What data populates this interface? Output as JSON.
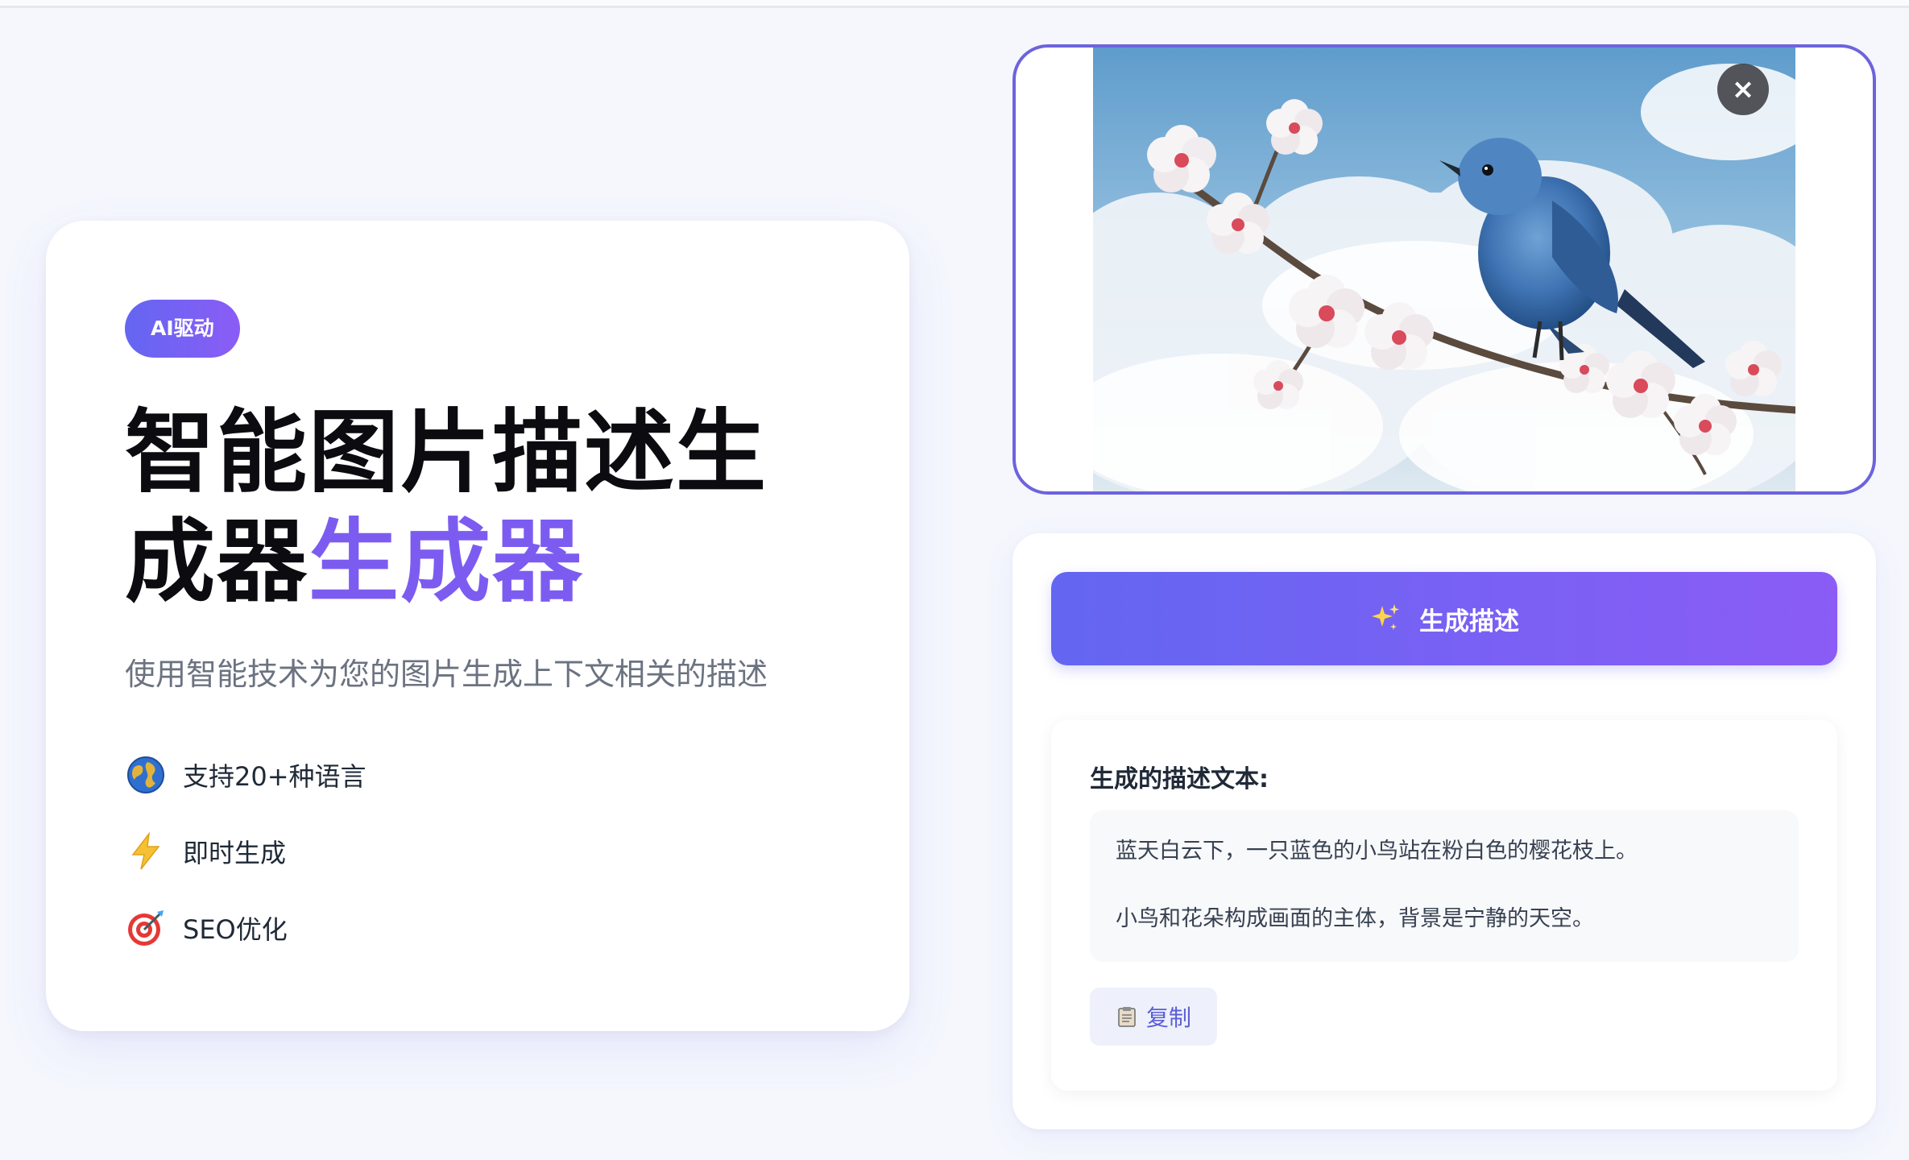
{
  "hero": {
    "badge": "AI驱动",
    "title_line1": "智能图片描述生",
    "title_line2_dark": "成器",
    "title_line2_accent": "生成器",
    "subtitle": "使用智能技术为您的图片生成上下文相关的描述",
    "features": [
      {
        "icon": "globe-icon",
        "label": "支持20+种语言"
      },
      {
        "icon": "lightning-icon",
        "label": "即时生成"
      },
      {
        "icon": "target-icon",
        "label": "SEO优化"
      }
    ]
  },
  "image_card": {
    "close_label": "×",
    "image_subject": "blue-bird-on-cherry-blossom-branch"
  },
  "generator": {
    "button_icon": "sparkles-icon",
    "button_label": "生成描述",
    "result_heading": "生成的描述文本:",
    "paragraphs": [
      "蓝天白云下，一只蓝色的小鸟站在粉白色的樱花枝上。",
      "小鸟和花朵构成画面的主体，背景是宁静的天空。"
    ],
    "copy_icon": "clipboard-icon",
    "copy_label": "复制"
  },
  "colors": {
    "accent": "#7c5cf0",
    "gradient_start": "#6366f1",
    "gradient_end": "#8b5cf6",
    "image_border": "#6d63dd"
  }
}
